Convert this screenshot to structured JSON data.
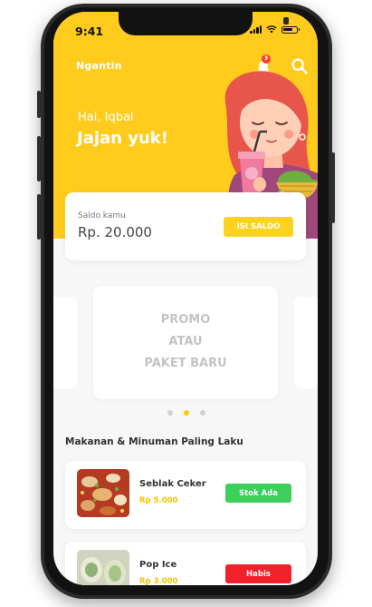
{
  "status_bar": {
    "time": "9:41"
  },
  "header": {
    "app_title": "Ngantin",
    "notification_count": "3",
    "greeting": "Hai, Iqbal",
    "headline": "Jajan yuk!"
  },
  "balance": {
    "label": "Saldo kamu",
    "value": "Rp. 20.000",
    "topup_label": "ISI SALDO"
  },
  "promo": {
    "lines": [
      "PROMO",
      "ATAU",
      "PAKET BARU"
    ],
    "active_index": 1,
    "count": 3
  },
  "best_seller": {
    "title": "Makanan & Minuman Paling Laku",
    "items": [
      {
        "name": "Seblak Ceker",
        "price": "Rp 5.000",
        "stock_label": "Stok Ada",
        "stock_color": "#3ccf5a"
      },
      {
        "name": "Pop Ice",
        "price": "Rp 3.000",
        "stock_label": "Habis",
        "stock_color": "#f2202a"
      }
    ]
  },
  "colors": {
    "accent": "#ffcc1d",
    "accent_button": "#ffd21f",
    "price": "#f2c500"
  }
}
